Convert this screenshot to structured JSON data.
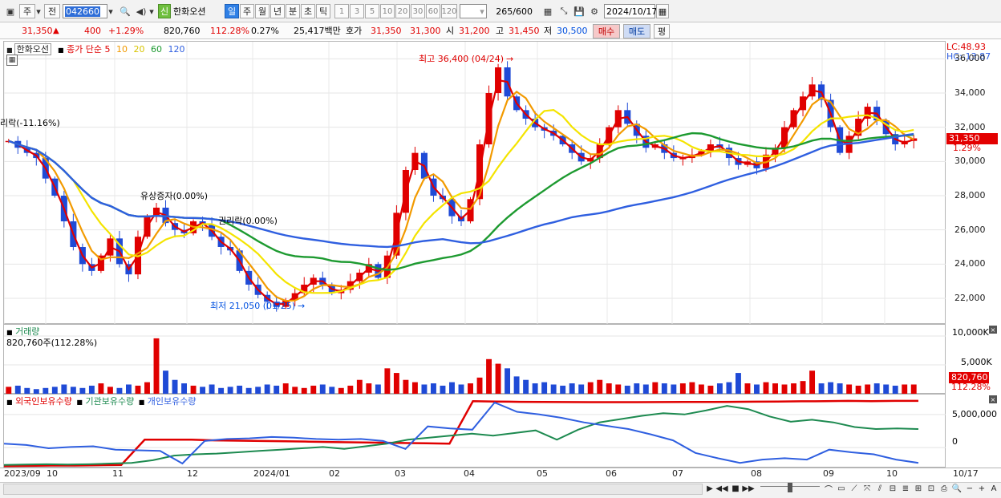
{
  "toolbar": {
    "market_label": "주",
    "prev_label": "전",
    "code": "042660",
    "company": "한화오션",
    "badge": "신",
    "periods": [
      "일",
      "주",
      "월",
      "년",
      "분",
      "초",
      "틱"
    ],
    "active_period": "일",
    "intervals": [
      "1",
      "3",
      "5",
      "10",
      "20",
      "30",
      "60",
      "120"
    ],
    "count": "265",
    "count_total": "/600",
    "date": "2024/10/17"
  },
  "quote": {
    "price": "31,350",
    "change": "400",
    "change_pct": "+1.29%",
    "volume": "820,760",
    "volume_ratio": "112.28%",
    "turnover": "0.27%",
    "amount": "25,417백만",
    "bid_label": "호가",
    "bid1": "31,350",
    "bid2": "31,300",
    "open_label": "시",
    "open": "31,200",
    "high_label": "고",
    "high": "31,450",
    "low_label": "저",
    "low": "30,500",
    "buy_label": "매수",
    "sell_label": "매도",
    "eval_label": "평"
  },
  "price_pane": {
    "name": "한화오선",
    "legend_prefix": "종가 단순",
    "ma": [
      {
        "label": "5",
        "color": "#e00000"
      },
      {
        "label": "10",
        "color": "#f29a00"
      },
      {
        "label": "20",
        "color": "#f4e400"
      },
      {
        "label": "60",
        "color": "#1d9a30"
      },
      {
        "label": "120",
        "color": "#2f5fe0"
      }
    ],
    "annotations": {
      "high": "최고 36,400 (04/24)",
      "low": "최저 21,050 (01/25)",
      "left_event": "리락(-11.16%)",
      "event1": "유상증자(0.00%)",
      "event2": "권리락(0.00%)"
    },
    "right": {
      "lc": "LC:48.93",
      "hc": "HC:-13.87",
      "price": "31,350",
      "pct": "1.29%"
    },
    "yticks": [
      "36,000",
      "34,000",
      "32,000",
      "30,000",
      "28,000",
      "26,000",
      "24,000",
      "22,000"
    ]
  },
  "volume_pane": {
    "title": "거래량",
    "value": "820,760주(112.28%)",
    "yticks": [
      "10,000K",
      "5,000K"
    ],
    "right": {
      "value": "820,760",
      "pct": "112.28%"
    }
  },
  "holder_pane": {
    "series": [
      {
        "label": "외국인보유수량",
        "color": "#e00000"
      },
      {
        "label": "기관보유수량",
        "color": "#1d8a50"
      },
      {
        "label": "개인보유수량",
        "color": "#2f5fe0"
      }
    ],
    "yticks": [
      "5,000,000",
      "0"
    ]
  },
  "xaxis": {
    "labels": [
      "2023/09",
      "10",
      "11",
      "12",
      "2024/01",
      "02",
      "03",
      "04",
      "05",
      "06",
      "07",
      "08",
      "09",
      "10",
      "10/17"
    ]
  },
  "chart_data": {
    "type": "candlestick",
    "price_ylim": [
      20500,
      37000
    ],
    "months": [
      "2023/09",
      "10",
      "11",
      "12",
      "2024/01",
      "02",
      "03",
      "04",
      "05",
      "06",
      "07",
      "08",
      "09",
      "10"
    ],
    "closes": [
      31200,
      30800,
      30500,
      30200,
      29000,
      28000,
      26500,
      25000,
      24000,
      23600,
      24500,
      25500,
      24000,
      23400,
      25600,
      26800,
      27300,
      26400,
      26000,
      25800,
      26500,
      26300,
      25600,
      25000,
      24800,
      23600,
      22800,
      22200,
      21800,
      21500,
      21900,
      22300,
      22800,
      23200,
      22800,
      22300,
      22500,
      23000,
      23500,
      24000,
      23200,
      24500,
      27000,
      29500,
      30500,
      29000,
      28000,
      27800,
      26800,
      26500,
      27800,
      31000,
      34000,
      35500,
      33800,
      33000,
      32500,
      32000,
      31800,
      31500,
      31000,
      30500,
      30000,
      30200,
      31000,
      32000,
      33000,
      32200,
      31500,
      30800,
      31000,
      30500,
      30200,
      30200,
      30400,
      30600,
      31000,
      30800,
      30200,
      29800,
      30000,
      29600,
      30400,
      30800,
      32000,
      33000,
      33800,
      34500,
      33600,
      32000,
      30500,
      31500,
      32500,
      33200,
      32400,
      31600,
      31000,
      31200,
      31350
    ],
    "high": {
      "value": 36400,
      "date": "04/24"
    },
    "low": {
      "value": 21050,
      "date": "01/25"
    },
    "volume_ylim": [
      0,
      10000000
    ],
    "volumes": [
      6,
      7,
      5,
      4,
      5,
      6,
      8,
      6,
      5,
      7,
      9,
      6,
      5,
      8,
      7,
      10,
      48,
      20,
      12,
      9,
      7,
      6,
      8,
      5,
      6,
      7,
      5,
      6,
      8,
      7,
      9,
      6,
      5,
      7,
      8,
      6,
      5,
      7,
      12,
      9,
      8,
      22,
      18,
      12,
      10,
      8,
      9,
      7,
      10,
      8,
      9,
      14,
      30,
      26,
      22,
      15,
      12,
      9,
      10,
      8,
      7,
      9,
      8,
      10,
      12,
      9,
      8,
      7,
      9,
      8,
      10,
      9,
      8,
      9,
      10,
      8,
      7,
      9,
      10,
      18,
      9,
      8,
      10,
      9,
      8,
      9,
      11,
      20,
      9,
      10,
      9,
      8,
      7,
      8,
      9,
      8,
      7,
      8,
      8
    ],
    "holders_ylim": [
      -3000000,
      8000000
    ],
    "foreign": [
      -2800000,
      -2750000,
      -2700000,
      -2700000,
      -2650000,
      -2600000,
      1200000,
      1200000,
      1200000,
      1100000,
      1050000,
      1000000,
      950000,
      900000,
      850000,
      800000,
      750000,
      700000,
      650000,
      600000,
      7000000,
      6950000,
      6900000,
      6880000,
      6860000,
      6850000,
      6850000,
      6850000,
      6860000,
      6870000,
      6880000,
      6900000,
      6920000,
      6950000,
      6980000,
      7000000,
      7050000,
      7000000,
      7050000,
      7050000
    ],
    "institution": [
      -2600000,
      -2550000,
      -2500000,
      -2550000,
      -2500000,
      -2400000,
      -2300000,
      -1900000,
      -1200000,
      -1000000,
      -900000,
      -700000,
      -500000,
      -300000,
      -100000,
      100000,
      -200000,
      200000,
      600000,
      1200000,
      1500000,
      1800000,
      2100000,
      1800000,
      2200000,
      2600000,
      1200000,
      2700000,
      3800000,
      4300000,
      4800000,
      5200000,
      5000000,
      5600000,
      6300000,
      5800000,
      4700000,
      3900000,
      4200000,
      3800000,
      3100000,
      2800000,
      2900000,
      2800000
    ],
    "individual": [
      600000,
      400000,
      -100000,
      100000,
      200000,
      -300000,
      -400000,
      -500000,
      -2400000,
      1000000,
      1300000,
      1400000,
      1600000,
      1500000,
      1300000,
      1200000,
      1300000,
      1000000,
      -200000,
      3200000,
      2900000,
      2700000,
      6800000,
      5400000,
      5000000,
      4500000,
      3800000,
      3300000,
      2800000,
      2000000,
      1100000,
      -800000,
      -1600000,
      -2300000,
      -1800000,
      -1600000,
      -1800000,
      -300000,
      -700000,
      -1000000,
      -1800000,
      -2300000
    ]
  }
}
